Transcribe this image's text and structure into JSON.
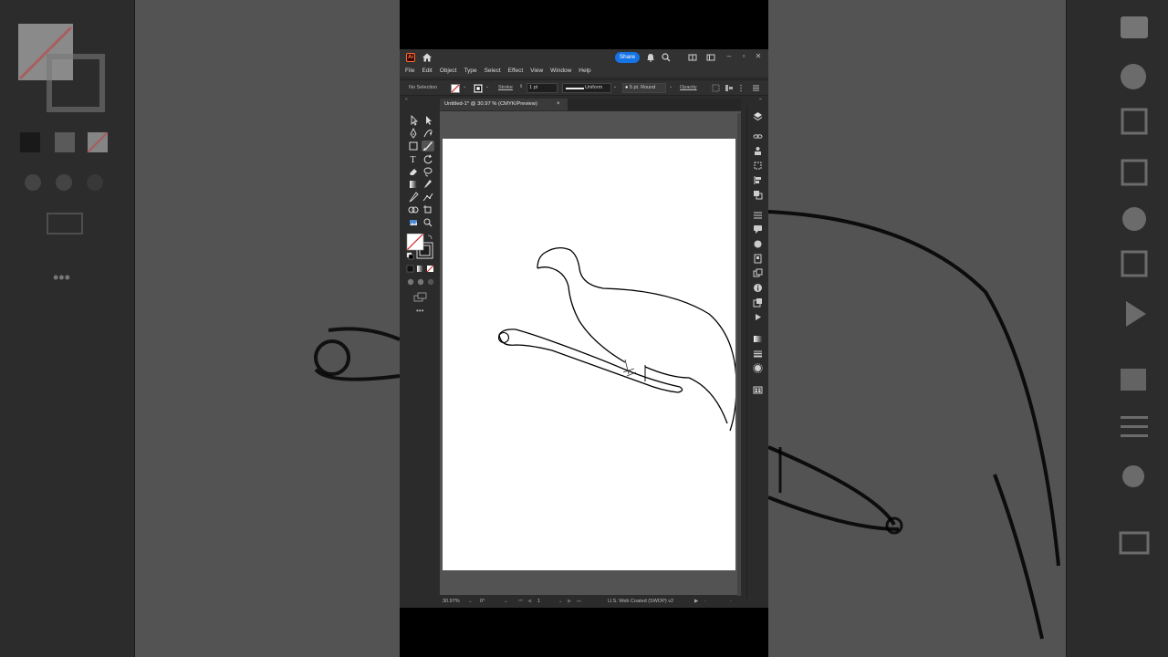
{
  "app": {
    "logo": "Ai",
    "share_label": "Share",
    "menu": [
      "File",
      "Edit",
      "Object",
      "Type",
      "Select",
      "Effect",
      "View",
      "Window",
      "Help"
    ]
  },
  "control_bar": {
    "selection": "No Selection",
    "stroke_label": "Stroke",
    "stroke_weight": "1 pt",
    "profile": "Uniform",
    "brush": "5 pt. Round",
    "opacity_label": "Opacity"
  },
  "document": {
    "tab_title": "Untitled-1* @ 30.97 % (CMYK/Preview)",
    "close": "×"
  },
  "status": {
    "zoom": "30.97%",
    "rotation": "0°",
    "artboard_num": "1",
    "color_profile": "U.S. Web Coated (SWOP) v2"
  },
  "icons": {
    "home": "home-icon",
    "bell": "bell-icon",
    "search": "search-icon",
    "arrange": "arrange-icon",
    "minimize": "minimize-icon",
    "maximize": "maximize-icon",
    "close": "close-icon"
  },
  "colors": {
    "accent": "#1473e6",
    "ui_dark": "#2b2b2b",
    "canvas": "#535353",
    "artboard": "#ffffff",
    "none_slash": "#d02020"
  }
}
